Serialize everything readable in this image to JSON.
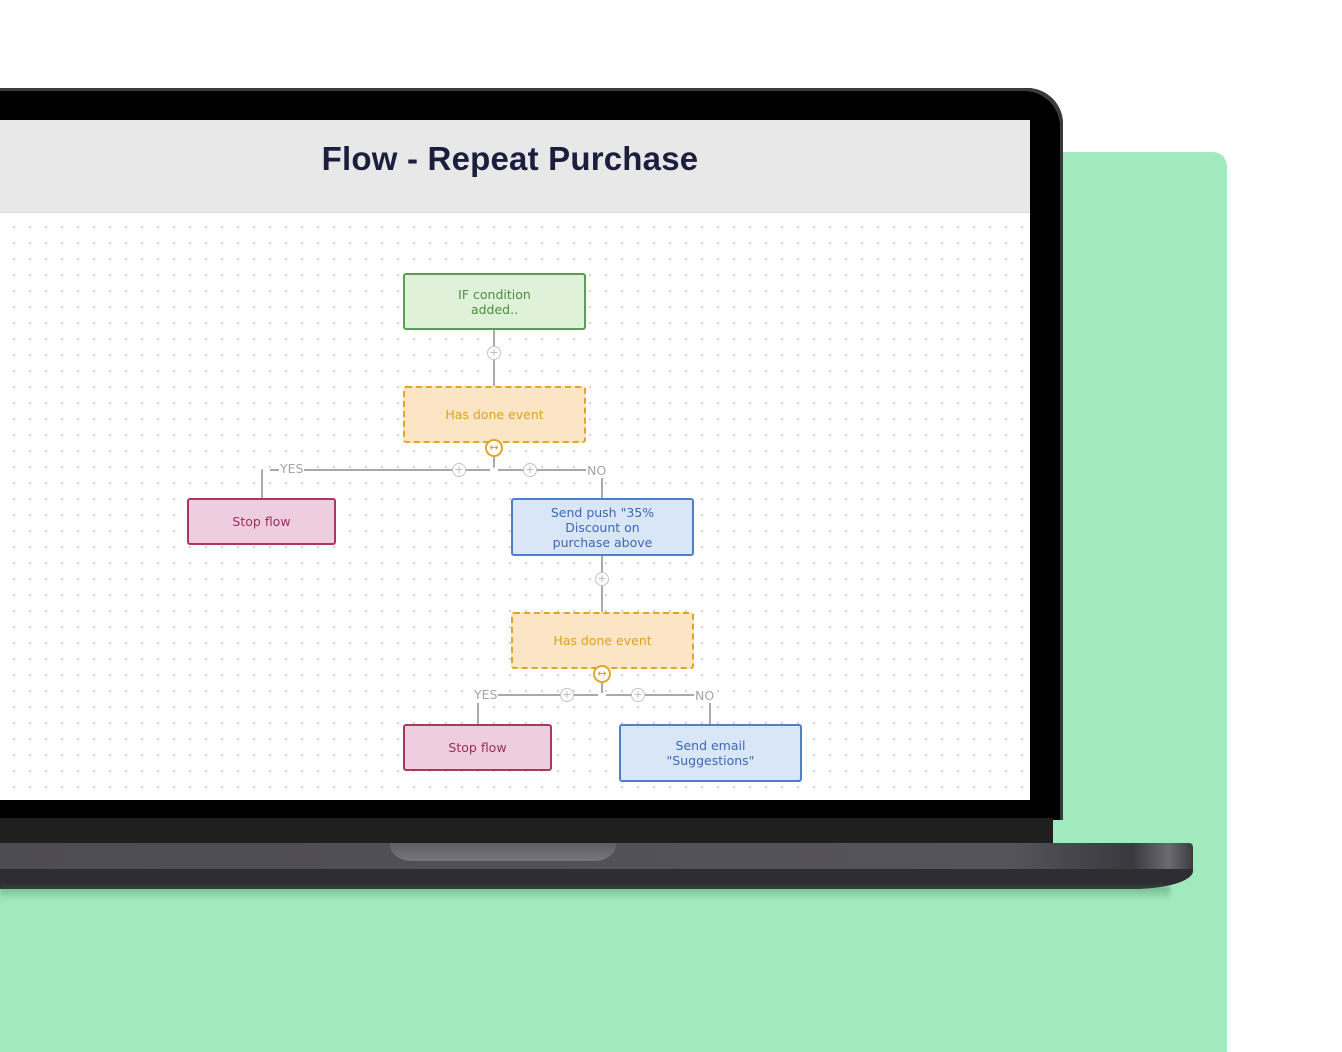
{
  "screen": {
    "title": "Flow - Repeat Purchase"
  },
  "flow": {
    "nodes": {
      "if_condition": {
        "label": "IF condition added..",
        "type": "condition"
      },
      "has_done_event_1": {
        "label": "Has done event",
        "type": "event-check"
      },
      "stop_flow_1": {
        "label": "Stop flow",
        "type": "stop"
      },
      "send_push": {
        "label": "Send push \"35% Discount on purchase above",
        "type": "push-action"
      },
      "has_done_event_2": {
        "label": "Has done event",
        "type": "event-check"
      },
      "stop_flow_2": {
        "label": "Stop flow",
        "type": "stop"
      },
      "send_email": {
        "label": "Send email \"Suggestions\"",
        "type": "email-action"
      }
    },
    "branch_labels": {
      "yes": "YES",
      "no": "NO"
    },
    "icons": {
      "add": "+",
      "toggle": "↔"
    }
  },
  "colors": {
    "background_card": "#a1eabf",
    "condition": "#5a9e4e",
    "event": "#e2a52a",
    "stop": "#a8385f",
    "action": "#4f7fc6",
    "title_text": "#1b1e3d"
  }
}
